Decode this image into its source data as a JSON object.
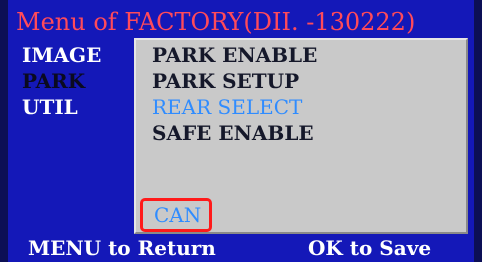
{
  "title": "Menu of  FACTORY(DII. -130222)",
  "side_menu": {
    "items": [
      {
        "label": "IMAGE"
      },
      {
        "label": "PARK"
      },
      {
        "label": "UTIL"
      }
    ]
  },
  "panel": {
    "items": [
      {
        "label": "PARK ENABLE"
      },
      {
        "label": "PARK SETUP"
      },
      {
        "label": "REAR SELECT"
      },
      {
        "label": "SAFE ENABLE"
      }
    ],
    "can_label": "CAN"
  },
  "footer": {
    "left": "MENU to Return",
    "right": "OK to Save"
  },
  "colors": {
    "background": "#1418b8",
    "title": "#ff4a5a",
    "panel": "#c9c9c9",
    "highlight": "#2f8cff",
    "marker": "#ff1a1a"
  }
}
